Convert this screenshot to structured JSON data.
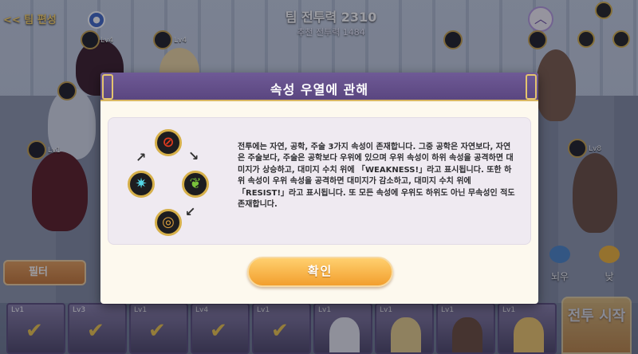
{
  "hud": {
    "back_label": "<< 팀 편성",
    "team_power": "팀 전투력 2310",
    "recommended_power": "추천 전투력 1484",
    "lv_labels": [
      "Lv4",
      "Lv4",
      "Lv1",
      "Lv8"
    ]
  },
  "modal": {
    "title": "속성 우열에 관해",
    "description": "전투에는 자연, 공학, 주술 3가지 속성이 존재합니다. 그중 공학은 자연보다, 자연은 주술보다, 주술은 공학보다 우위에 있으며 우위 속성이 하위 속성을 공격하면 대미지가 상승하고, 대미지 수치 위에 「WEAKNESS!」라고 표시됩니다. 또한 하위 속성이 우위 속성을 공격하면 대미지가 감소하고, 대미지 수치 위에 「RESIST!」라고 표시됩니다. 또 모든 속성에 우위도 하위도 아닌 무속성인 적도 존재합니다.",
    "confirm_label": "확인"
  },
  "footer": {
    "filter_label": "필터",
    "weather": [
      {
        "label": "뇌우",
        "icon": "storm-icon"
      },
      {
        "label": "낮",
        "icon": "sun-icon"
      }
    ],
    "start_label": "전투 시작",
    "roster_lv": [
      "Lv1",
      "Lv3",
      "Lv1",
      "Lv4",
      "Lv1",
      "Lv1",
      "Lv1",
      "Lv1",
      "Lv1"
    ]
  },
  "colors": {
    "header": "#6f5a96",
    "gold": "#d6b04a",
    "confirm": "#f29f2e",
    "curse": "#e03a1e",
    "nature": "#79c23a",
    "magic": "#55d7e8",
    "tech": "#e0a23e"
  }
}
